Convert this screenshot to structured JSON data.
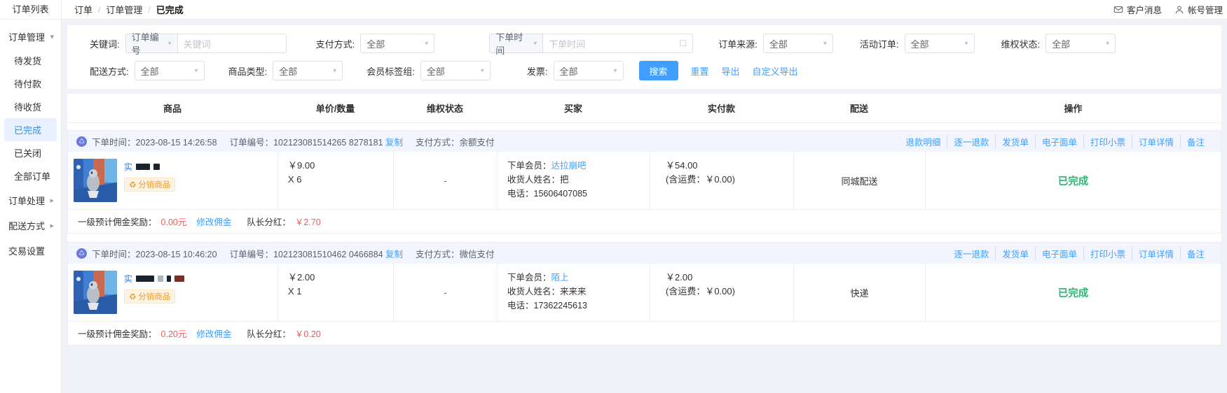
{
  "topbar": {
    "title": "订单列表",
    "breadcrumbs": [
      {
        "label": "订单",
        "active": false
      },
      {
        "label": "订单管理",
        "active": false
      },
      {
        "label": "已完成",
        "active": true
      }
    ],
    "separator": "/",
    "right": [
      {
        "icon": "message-icon",
        "label": "客户消息"
      },
      {
        "icon": "user-icon",
        "label": "帐号管理"
      }
    ]
  },
  "sidebar": {
    "groups": [
      {
        "label": "订单管理",
        "caret": "chevron-down",
        "expanded": true
      },
      {
        "label": "订单处理",
        "caret": "chevron-right",
        "expanded": false
      },
      {
        "label": "配送方式",
        "caret": "chevron-right",
        "expanded": false
      },
      {
        "label": "交易设置",
        "caret": "",
        "expanded": false
      }
    ],
    "items": [
      {
        "label": "待发货",
        "active": false
      },
      {
        "label": "待付款",
        "active": false
      },
      {
        "label": "待收货",
        "active": false
      },
      {
        "label": "已完成",
        "active": true
      },
      {
        "label": "已关闭",
        "active": false
      },
      {
        "label": "全部订单",
        "active": false
      }
    ]
  },
  "filters": {
    "keyword": {
      "label": "关键词:",
      "select_value": "订单编号",
      "input_value": "",
      "input_placeholder": "关键词"
    },
    "pay_method": {
      "label": "支付方式:",
      "value": "全部"
    },
    "order_time": {
      "label_select": "下单时间",
      "input_value": "",
      "input_placeholder": "下单时间",
      "icon": "calendar-icon"
    },
    "order_source": {
      "label": "订单来源:",
      "value": "全部"
    },
    "activity_order": {
      "label": "活动订单:",
      "value": "全部"
    },
    "rights_status": {
      "label": "维权状态:",
      "value": "全部"
    },
    "delivery_method": {
      "label": "配送方式:",
      "value": "全部"
    },
    "goods_type": {
      "label": "商品类型:",
      "value": "全部"
    },
    "member_tag": {
      "label": "会员标签组:",
      "value": "全部"
    },
    "invoice": {
      "label": "发票:",
      "value": "全部"
    },
    "actions": {
      "search": "搜索",
      "reset": "重置",
      "export": "导出",
      "custom_export": "自定义导出"
    }
  },
  "table": {
    "headers": [
      "商品",
      "单价/数量",
      "维权状态",
      "买家",
      "实付款",
      "配送",
      "操作"
    ]
  },
  "orders": [
    {
      "bar": {
        "badge_icon": "pay-icon",
        "time_label": "下单时间：",
        "time_value": "2023-08-15 14:26:58",
        "no_label": "订单编号：",
        "no_value": "102123081514265 8278181",
        "copy": "复制",
        "pay_label": "支付方式：",
        "pay_value": "余额支付"
      },
      "ops": [
        "退款明细",
        "逐一退款",
        "发货单",
        "电子面单",
        "打印小票",
        "订单详情",
        "备注"
      ],
      "product": {
        "tag": "实",
        "title_redacted": true,
        "badge": "分销商品",
        "badge_icon": "share-icon"
      },
      "price": "￥9.00",
      "qty": "X 6",
      "rights_status": "-",
      "buyer": {
        "member_label": "下单会员：",
        "member_name": "达拉崩吧",
        "receiver_label": "收货人姓名：",
        "receiver_name": "把",
        "phone_label": "电话：",
        "phone_value": "15606407085"
      },
      "paid": "￥54.00",
      "freight": "(含运费：￥0.00)",
      "shipping": "同城配送",
      "status": "已完成",
      "commission": {
        "label": "一级预计佣金奖励：",
        "value": "0.00元",
        "link": "修改佣金",
        "leader_label": "队长分红：",
        "leader_value": "￥2.70"
      }
    },
    {
      "bar": {
        "badge_icon": "pay-icon",
        "time_label": "下单时间：",
        "time_value": "2023-08-15 10:46:20",
        "no_label": "订单编号：",
        "no_value": "102123081510462 0466884",
        "copy": "复制",
        "pay_label": "支付方式：",
        "pay_value": "微信支付"
      },
      "ops": [
        "逐一退款",
        "发货单",
        "电子面单",
        "打印小票",
        "订单详情",
        "备注"
      ],
      "product": {
        "tag": "实",
        "title_redacted": true,
        "badge": "分销商品",
        "badge_icon": "share-icon"
      },
      "price": "￥2.00",
      "qty": "X 1",
      "rights_status": "-",
      "buyer": {
        "member_label": "下单会员：",
        "member_name": "陌上",
        "receiver_label": "收货人姓名：",
        "receiver_name": "来来来",
        "phone_label": "电话：",
        "phone_value": "17362245613"
      },
      "paid": "￥2.00",
      "freight": "(含运费：￥0.00)",
      "shipping": "快递",
      "status": "已完成",
      "commission": {
        "label": "一级预计佣金奖励：",
        "value": "0.20元",
        "link": "修改佣金",
        "leader_label": "队长分红：",
        "leader_value": "￥0.20"
      }
    }
  ],
  "colors": {
    "accent": "#409eff",
    "success": "#2bb673",
    "danger": "#f05b5b",
    "bar_bg": "#f2f5fd"
  }
}
